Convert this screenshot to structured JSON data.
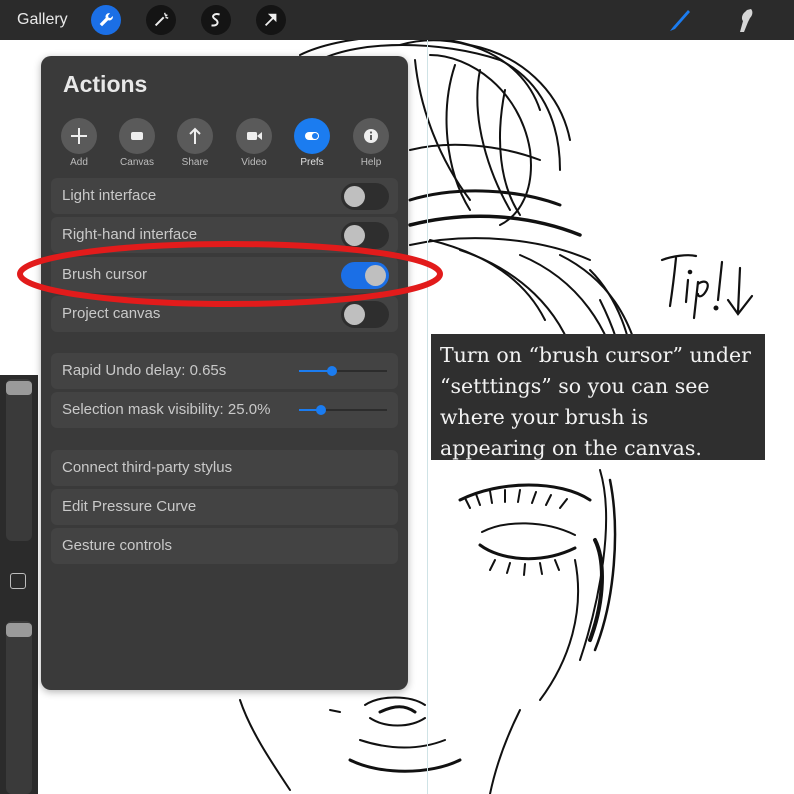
{
  "topbar": {
    "gallery_label": "Gallery",
    "tools": [
      "wrench-icon",
      "magic-wand-icon",
      "selection-s-icon",
      "arrow-cursor-icon"
    ],
    "active_tool": "wrench-icon",
    "right_tools": [
      "brush-icon",
      "smudge-icon"
    ],
    "accent_color": "#1b6fe6"
  },
  "actions": {
    "title": "Actions",
    "tabs": [
      {
        "label": "Add",
        "icon": "plus-icon"
      },
      {
        "label": "Canvas",
        "icon": "canvas-icon"
      },
      {
        "label": "Share",
        "icon": "share-icon"
      },
      {
        "label": "Video",
        "icon": "video-icon"
      },
      {
        "label": "Prefs",
        "icon": "toggle-icon",
        "active": true
      },
      {
        "label": "Help",
        "icon": "info-icon"
      }
    ],
    "toggles": [
      {
        "label": "Light interface",
        "on": false
      },
      {
        "label": "Right-hand interface",
        "on": false
      },
      {
        "label": "Brush cursor",
        "on": true
      },
      {
        "label": "Project canvas",
        "on": false
      }
    ],
    "sliders": [
      {
        "label": "Rapid Undo delay: 0.65s",
        "fraction": 0.38
      },
      {
        "label": "Selection mask visibility: 25.0%",
        "fraction": 0.25
      }
    ],
    "links": [
      "Connect third-party stylus",
      "Edit Pressure Curve",
      "Gesture controls"
    ]
  },
  "annotation": {
    "handwritten": "Tip!↓",
    "tip_text": "Turn on “brush cursor” under “setttings” so you can see where your brush is appearing on the canvas.",
    "highlight_color": "#e21b1b"
  }
}
